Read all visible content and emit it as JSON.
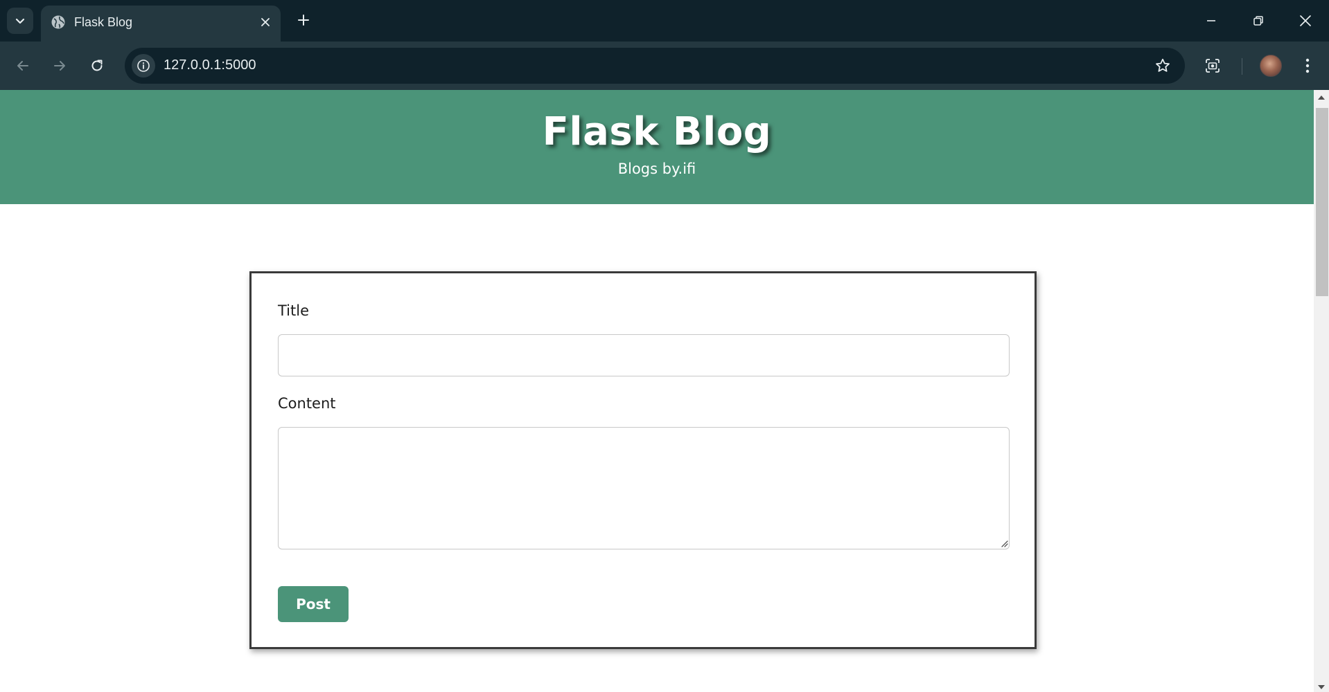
{
  "browser": {
    "tab": {
      "title": "Flask Blog"
    },
    "address": {
      "url": "127.0.0.1:5000"
    }
  },
  "site": {
    "title": "Flask Blog",
    "subtitle": "Blogs by.ifi"
  },
  "form": {
    "title_label": "Title",
    "title_value": "",
    "content_label": "Content",
    "content_value": "",
    "submit_label": "Post"
  },
  "colors": {
    "header_bg": "#4b9479",
    "button_bg": "#4b9479",
    "chrome_dark": "#0f222b",
    "chrome_toolbar": "#243840"
  },
  "icons": {
    "tab_search": "chevron-down-icon",
    "favicon": "globe-icon",
    "tab_close": "close-icon",
    "new_tab": "plus-icon",
    "minimize": "minimize-icon",
    "restore": "restore-icon",
    "close_window": "close-icon",
    "back": "back-arrow-icon",
    "forward": "forward-arrow-icon",
    "reload": "reload-icon",
    "site_info": "info-icon",
    "bookmark": "star-icon",
    "screenshot": "camera-icon",
    "menu": "kebab-menu-icon"
  }
}
